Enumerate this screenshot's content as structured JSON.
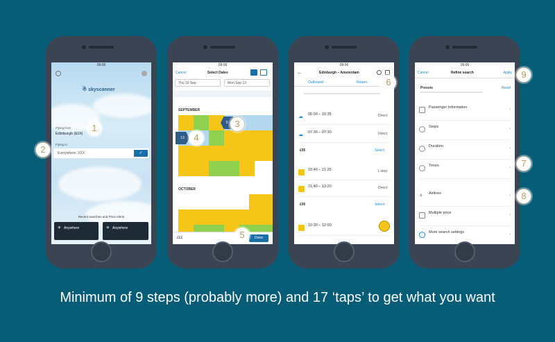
{
  "caption": "Minimum of 9 steps (probably more) and 17 ‘taps’ to get what you want",
  "badges": [
    "1",
    "2",
    "3",
    "4",
    "5",
    "6",
    "7",
    "8",
    "9"
  ],
  "status_time": "09:06",
  "phone1": {
    "logo": "skyscanner",
    "from_label": "Flying from",
    "from_value": "Edinburgh (EDI)",
    "to_label": "Flying to",
    "to_placeholder": "Everywhere, XXX",
    "recent": "Recent searches and Price Alerts",
    "card1": "Anywhere",
    "card2": "Anywhere"
  },
  "phone2": {
    "cancel": "Cancel",
    "title": "Select Dates",
    "from_field": "Thu 16 Sep",
    "to_field": "Mon Sep 13",
    "month1": "SEPTEMBER",
    "month2": "OCTOBER",
    "day_selected_1": "9",
    "day_selected_2": "13",
    "price": "£££",
    "done": "Done"
  },
  "phone3": {
    "title": "Edinburgh – Amsterdam",
    "tab1": "Outbound",
    "tab2": "Return",
    "section_price": "£95",
    "section_price2": "£95",
    "select": "Select",
    "flights": [
      {
        "time": "06:00 – 10:35",
        "tag": "Direct"
      },
      {
        "time": "07:30 – 07:30",
        "tag": "Direct"
      },
      {
        "time": "15:40 – 21:25",
        "tag": "1 stop"
      },
      {
        "time": "21:40 – 13:20",
        "tag": "Direct"
      },
      {
        "time": "10:30 – 12:00",
        "tag": "Direct"
      }
    ]
  },
  "phone4": {
    "cancel": "Cancel",
    "title": "Refine search",
    "apply": "Apply",
    "presets": "Presets",
    "reset": "Reset",
    "items": [
      "Passenger Information",
      "Stops",
      "Duration",
      "Times",
      "Airlines",
      "Multiple price",
      "More search settings"
    ]
  }
}
